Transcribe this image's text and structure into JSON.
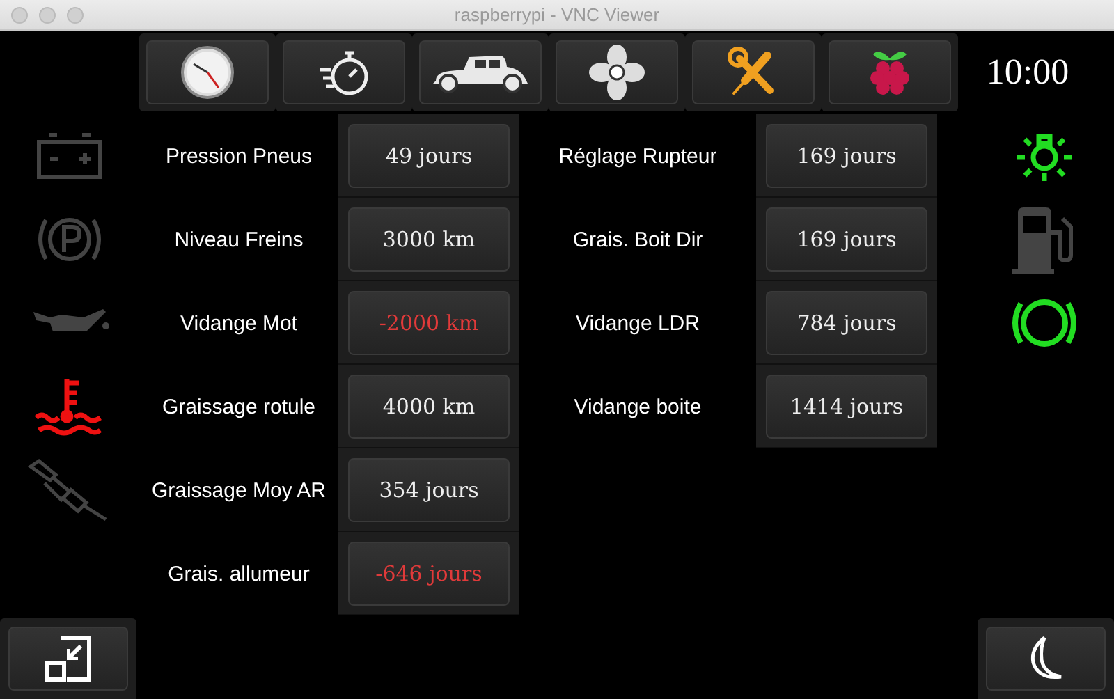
{
  "window": {
    "title": "raspberrypi - VNC Viewer"
  },
  "nav": [
    {
      "kind": "clock"
    },
    {
      "kind": "stopwatch"
    },
    {
      "kind": "car"
    },
    {
      "kind": "fan"
    },
    {
      "kind": "tools"
    },
    {
      "kind": "raspberry"
    }
  ],
  "clock": "10:00",
  "left_indicators": [
    {
      "kind": "battery",
      "color": "#444444"
    },
    {
      "kind": "parking",
      "color": "#444444"
    },
    {
      "kind": "oil",
      "color": "#444444"
    },
    {
      "kind": "temperature",
      "color": "#ee1111"
    },
    {
      "kind": "spark",
      "color": "#444444"
    }
  ],
  "maintenance_left": [
    {
      "label": "Pression Pneus",
      "value": "49 jours",
      "overdue": false
    },
    {
      "label": "Niveau Freins",
      "value": "3000 km",
      "overdue": false
    },
    {
      "label": "Vidange Mot",
      "value": "-2000 km",
      "overdue": true
    },
    {
      "label": "Graissage rotule",
      "value": "4000 km",
      "overdue": false
    },
    {
      "label": "Graissage Moy AR",
      "value": "354 jours",
      "overdue": false
    },
    {
      "label": "Grais. allumeur",
      "value": "-646 jours",
      "overdue": true
    }
  ],
  "maintenance_right": [
    {
      "label": "Réglage Rupteur",
      "value": "169 jours",
      "overdue": false
    },
    {
      "label": "Grais. Boit Dir",
      "value": "169 jours",
      "overdue": false
    },
    {
      "label": "Vidange LDR",
      "value": "784 jours",
      "overdue": false
    },
    {
      "label": "Vidange boite",
      "value": "1414 jours",
      "overdue": false
    }
  ],
  "right_indicators": [
    {
      "kind": "light",
      "color": "#22dd22"
    },
    {
      "kind": "fuel",
      "color": "#444444"
    },
    {
      "kind": "brake",
      "color": "#22dd22"
    }
  ],
  "bottom_buttons": [
    {
      "kind": "resize"
    },
    {
      "kind": "moon"
    }
  ]
}
